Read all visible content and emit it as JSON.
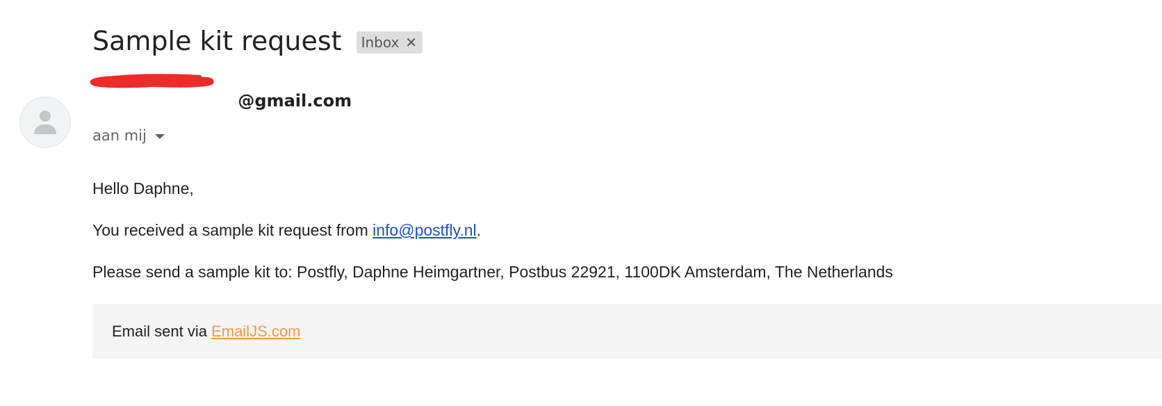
{
  "email": {
    "subject": "Sample kit request",
    "label": {
      "text": "Inbox",
      "close_glyph": "✕"
    },
    "sender": {
      "email_visible_part": "@gmail.com",
      "avatar_icon": "person-icon",
      "redaction_color": "#ee2a2a"
    },
    "recipient": "aan mij",
    "body": {
      "greeting": "Hello Daphne,",
      "line1_prefix": "You received a sample kit request from ",
      "line1_link": "info@postfly.nl",
      "line1_suffix": ".",
      "line2": "Please send a sample kit to: Postfly, Daphne Heimgartner, Postbus 22921, 1100DK Amsterdam, The Netherlands"
    },
    "footer": {
      "prefix": "Email sent via ",
      "link": "EmailJS.com",
      "link_color": "#f09a4b"
    }
  },
  "colors": {
    "text": "#202124",
    "secondary_text": "#5f6368",
    "link_blue": "#1a53c7",
    "chip_bg": "#dddddd",
    "footer_bg": "#f4f4f4"
  }
}
